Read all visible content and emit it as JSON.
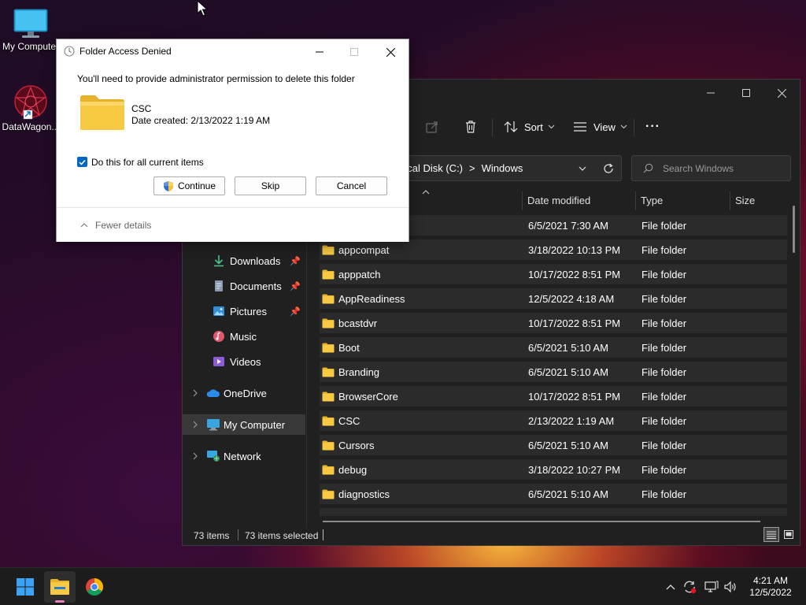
{
  "desktop": {
    "icons": [
      {
        "label": "My Computer"
      },
      {
        "label": "DataWagon..."
      }
    ]
  },
  "explorer": {
    "toolbar": {
      "sort_label": "Sort",
      "view_label": "View",
      "more_label": "···"
    },
    "address": {
      "segment1": "ocal Disk (C:)",
      "separator": ">",
      "segment2": "Windows"
    },
    "search": {
      "placeholder": "Search Windows"
    },
    "sidebar": {
      "items": [
        {
          "label": "Downloads",
          "icon": "download-icon"
        },
        {
          "label": "Documents",
          "icon": "documents-icon"
        },
        {
          "label": "Pictures",
          "icon": "pictures-icon"
        },
        {
          "label": "Music",
          "icon": "music-icon"
        },
        {
          "label": "Videos",
          "icon": "videos-icon"
        },
        {
          "label": "OneDrive",
          "icon": "onedrive-icon"
        },
        {
          "label": "My Computer",
          "icon": "computer-icon"
        },
        {
          "label": "Network",
          "icon": "network-icon"
        }
      ]
    },
    "columns": {
      "date": "Date modified",
      "type": "Type",
      "size": "Size"
    },
    "rows": [
      {
        "name": "",
        "date": "6/5/2021 7:30 AM",
        "type": "File folder"
      },
      {
        "name": "appcompat",
        "date": "3/18/2022 10:13 PM",
        "type": "File folder"
      },
      {
        "name": "apppatch",
        "date": "10/17/2022 8:51 PM",
        "type": "File folder"
      },
      {
        "name": "AppReadiness",
        "date": "12/5/2022 4:18 AM",
        "type": "File folder"
      },
      {
        "name": "bcastdvr",
        "date": "10/17/2022 8:51 PM",
        "type": "File folder"
      },
      {
        "name": "Boot",
        "date": "6/5/2021 5:10 AM",
        "type": "File folder"
      },
      {
        "name": "Branding",
        "date": "6/5/2021 5:10 AM",
        "type": "File folder"
      },
      {
        "name": "BrowserCore",
        "date": "10/17/2022 8:51 PM",
        "type": "File folder"
      },
      {
        "name": "CSC",
        "date": "2/13/2022 1:19 AM",
        "type": "File folder"
      },
      {
        "name": "Cursors",
        "date": "6/5/2021 5:10 AM",
        "type": "File folder"
      },
      {
        "name": "debug",
        "date": "3/18/2022 10:27 PM",
        "type": "File folder"
      },
      {
        "name": "diagnostics",
        "date": "6/5/2021 5:10 AM",
        "type": "File folder"
      }
    ],
    "status": {
      "count": "73 items",
      "selected": "73 items selected"
    }
  },
  "dialog": {
    "title": "Folder Access Denied",
    "message": "You'll need to provide administrator permission to delete this folder",
    "folder_name": "CSC",
    "date_created": "Date created: 2/13/2022 1:19 AM",
    "checkbox_label": "Do this for all current items",
    "checkbox_checked": true,
    "buttons": {
      "continue": "Continue",
      "skip": "Skip",
      "cancel": "Cancel"
    },
    "fewer_details": "Fewer details"
  },
  "taskbar": {
    "time": "4:21 AM",
    "date": "12/5/2022"
  },
  "colors": {
    "accent": "#0067c0",
    "folder_yellow": "#f8c943",
    "explorer_bg": "#202020",
    "row_bg": "#2b2b2b",
    "taskbar_bg": "#1c1c1c"
  }
}
